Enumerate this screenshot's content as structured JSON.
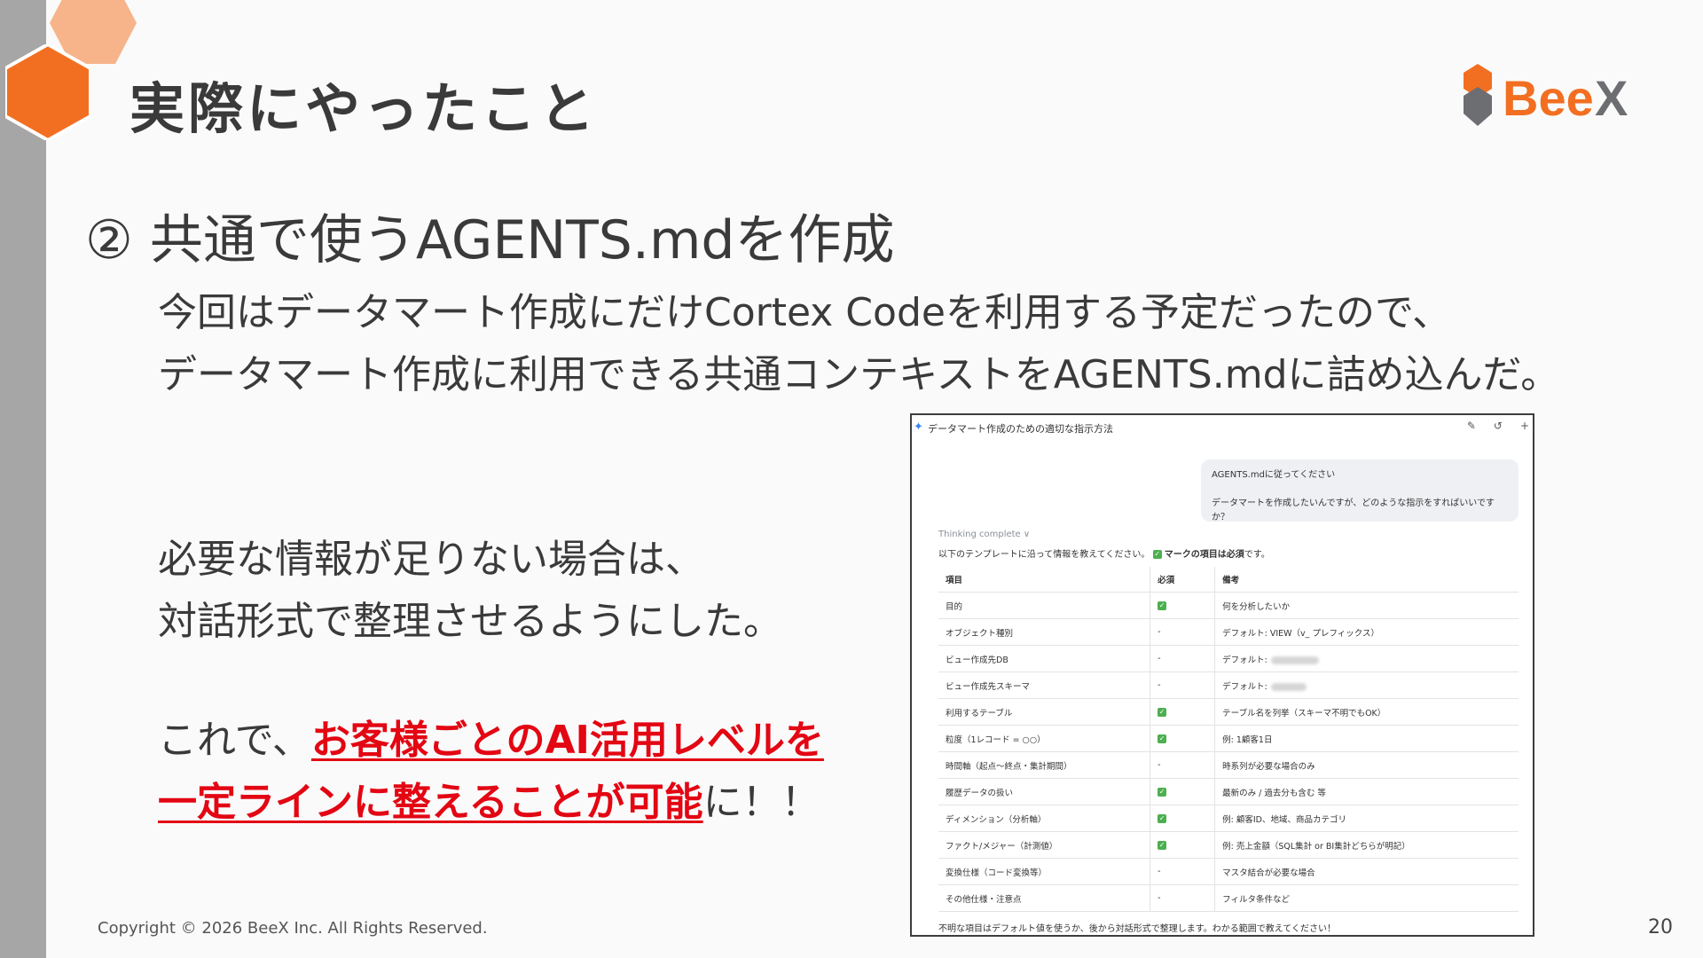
{
  "slide": {
    "title": "実際にやったこと",
    "logo_text": "BeeX",
    "subheading": "② 共通で使うAGENTS.mdを作成",
    "intro_line1": "今回はデータマート作成にだけCortex Codeを利用する予定だったので、",
    "intro_line2": "データマート作成に利用できる共通コンテキストをAGENTS.mdに詰め込んだ。",
    "note_line1": "必要な情報が足りない場合は、",
    "note_line2": "対話形式で整理させるようにした。",
    "conclusion_prefix": "これで、",
    "conclusion_highlight1": "お客様ごとのAI活用レベルを",
    "conclusion_highlight2": "一定ラインに整えることが可能",
    "conclusion_suffix": "に！！",
    "copyright": "Copyright © 2026 BeeX Inc. All Rights Reserved.",
    "page_number": "20"
  },
  "screenshot": {
    "title": "データマート作成のための適切な指示方法",
    "user_message_line1": "AGENTS.mdに従ってください",
    "user_message_line2": "データマートを作成したいんですが、どのような指示をすればいいですか？",
    "thinking": "Thinking complete ∨",
    "instruction_prefix": "以下のテンプレートに沿って情報を教えてください。",
    "instruction_bold": "マークの項目は必須",
    "instruction_suffix": "です。",
    "table_headers": [
      "項目",
      "必須",
      "備考"
    ],
    "table_rows": [
      {
        "item": "目的",
        "required": "check",
        "note": "何を分析したいか"
      },
      {
        "item": "オブジェクト種別",
        "required": "-",
        "note": "デフォルト: VIEW（v_ プレフィックス）"
      },
      {
        "item": "ビュー作成先DB",
        "required": "-",
        "note": "デフォルト:",
        "blurred": true
      },
      {
        "item": "ビュー作成先スキーマ",
        "required": "-",
        "note": "デフォルト:",
        "blurred": true
      },
      {
        "item": "利用するテーブル",
        "required": "check",
        "note": "テーブル名を列挙（スキーマ不明でもOK）"
      },
      {
        "item": "粒度（1レコード = ○○）",
        "required": "check",
        "note": "例: 1顧客1日"
      },
      {
        "item": "時間軸（起点〜終点・集計期間）",
        "required": "-",
        "note": "時系列が必要な場合のみ"
      },
      {
        "item": "履歴データの扱い",
        "required": "check",
        "note": "最新のみ / 過去分も含む 等"
      },
      {
        "item": "ディメンション（分析軸）",
        "required": "check",
        "note": "例: 顧客ID、地域、商品カテゴリ"
      },
      {
        "item": "ファクト/メジャー（計測値）",
        "required": "check",
        "note": "例: 売上金額（SQL集計 or BI集計どちらが明記）"
      },
      {
        "item": "変換仕様（コード変換等）",
        "required": "-",
        "note": "マスタ結合が必要な場合"
      },
      {
        "item": "その他仕様・注意点",
        "required": "-",
        "note": "フィルタ条件など"
      }
    ],
    "footer": "不明な項目はデフォルト値を使うか、後から対話形式で整理します。わかる範囲で教えてください！",
    "icons": [
      "edit-icon",
      "history-icon",
      "add-icon"
    ]
  },
  "colors": {
    "accent_orange": "#f26f21",
    "highlight_red": "#e30613",
    "left_bar_gray": "#a6a6a6",
    "logo_gray": "#6d6e71"
  }
}
